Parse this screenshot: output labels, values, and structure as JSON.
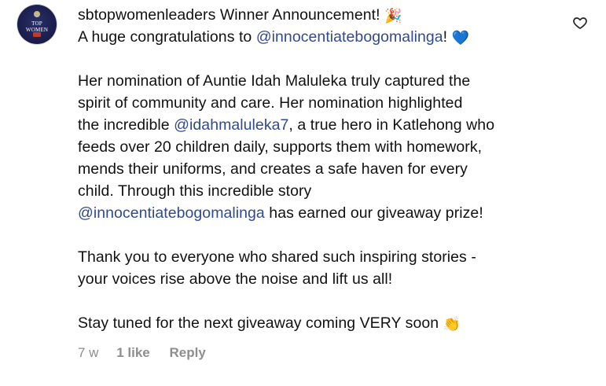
{
  "comment": {
    "username": "sbtopwomenleaders",
    "avatar": {
      "logo_text": "TOP WOMEN",
      "colors": {
        "background": "#1b1f4d",
        "accent": "#c0392b"
      }
    },
    "lines": [
      {
        "text": " Winner Announcement! ",
        "emoji": "party-popper"
      },
      {
        "prefix": "A huge congratulations to ",
        "mention": "@innocentiatebogomalinga",
        "suffix": "! ",
        "emoji": "blue-heart"
      },
      {
        "blank": true
      },
      {
        "text": "Her nomination of Auntie Idah Maluleka truly captured the"
      },
      {
        "text": "spirit of community and care. Her nomination highlighted"
      },
      {
        "prefix": "the incredible ",
        "mention": "@idahmaluleka7",
        "suffix": ", a true hero in Katlehong who"
      },
      {
        "text": "feeds over 20 children daily, supports them with homework,"
      },
      {
        "text": "mends their uniforms, and creates a safe haven for every"
      },
      {
        "text": "child. Through this incredible story"
      },
      {
        "prefix": "",
        "mention": "@innocentiatebogomalinga",
        "suffix": " has earned our giveaway prize!"
      },
      {
        "blank": true
      },
      {
        "text": "Thank you to everyone who shared such inspiring stories -"
      },
      {
        "text": "your voices rise above the noise and lift us all!"
      },
      {
        "blank": true
      },
      {
        "text": "Stay tuned for the next giveaway coming VERY soon ",
        "emoji": "clapping-hands"
      }
    ],
    "footer": {
      "time": "7 w",
      "likes": "1 like",
      "reply": "Reply"
    },
    "icons": {
      "like": "heart-outline-icon"
    },
    "colors": {
      "text": "#111111",
      "mention": "#2f4a8f",
      "muted": "#8e8e8e",
      "heart_emoji": "#3a6fd8"
    }
  }
}
